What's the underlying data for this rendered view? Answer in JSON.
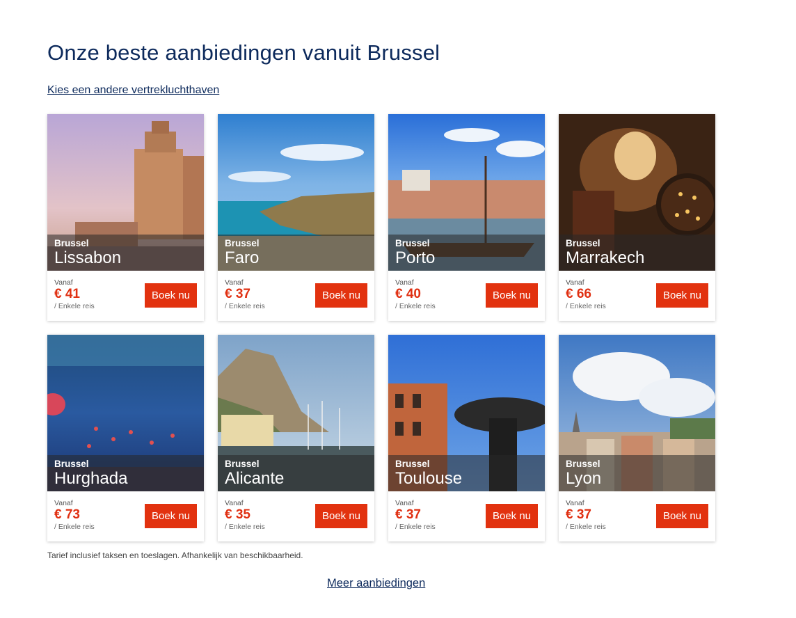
{
  "header": {
    "title": "Onze beste aanbiedingen vanuit Brussel",
    "change_airport_link": "Kies een andere vertrekluchthaven"
  },
  "cards": [
    {
      "origin": "Brussel",
      "destination": "Lissabon",
      "from_label": "Vanaf",
      "price": "€ 41",
      "trip_type": "/ Enkele reis",
      "button": "Boek nu"
    },
    {
      "origin": "Brussel",
      "destination": "Faro",
      "from_label": "Vanaf",
      "price": "€ 37",
      "trip_type": "/ Enkele reis",
      "button": "Boek nu"
    },
    {
      "origin": "Brussel",
      "destination": "Porto",
      "from_label": "Vanaf",
      "price": "€ 40",
      "trip_type": "/ Enkele reis",
      "button": "Boek nu"
    },
    {
      "origin": "Brussel",
      "destination": "Marrakech",
      "from_label": "Vanaf",
      "price": "€ 66",
      "trip_type": "/ Enkele reis",
      "button": "Boek nu"
    },
    {
      "origin": "Brussel",
      "destination": "Hurghada",
      "from_label": "Vanaf",
      "price": "€ 73",
      "trip_type": "/ Enkele reis",
      "button": "Boek nu"
    },
    {
      "origin": "Brussel",
      "destination": "Alicante",
      "from_label": "Vanaf",
      "price": "€ 35",
      "trip_type": "/ Enkele reis",
      "button": "Boek nu"
    },
    {
      "origin": "Brussel",
      "destination": "Toulouse",
      "from_label": "Vanaf",
      "price": "€ 37",
      "trip_type": "/ Enkele reis",
      "button": "Boek nu"
    },
    {
      "origin": "Brussel",
      "destination": "Lyon",
      "from_label": "Vanaf",
      "price": "€ 37",
      "trip_type": "/ Enkele reis",
      "button": "Boek nu"
    }
  ],
  "footer": {
    "disclaimer": "Tarief inclusief taksen en toeslagen. Afhankelijk van beschikbaarheid.",
    "more_link": "Meer aanbiedingen"
  },
  "colors": {
    "title": "#0d2a5c",
    "price": "#e03012",
    "button": "#e2320f"
  }
}
